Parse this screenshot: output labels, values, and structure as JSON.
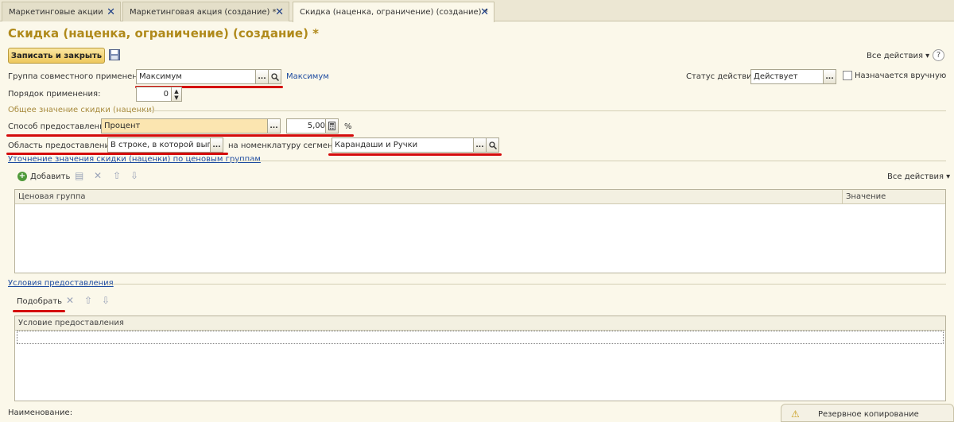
{
  "tabs": [
    {
      "label": "Маркетинговые акции"
    },
    {
      "label": "Маркетинговая акция (создание) *"
    },
    {
      "label": "Скидка (наценка, ограничение) (создание) *"
    }
  ],
  "page_title": "Скидка (наценка, ограничение) (создание) *",
  "toolbar": {
    "save_close": "Записать и закрыть",
    "all_actions": "Все действия"
  },
  "group": {
    "label": "Группа совместного применения:",
    "value": "Максимум",
    "link": "Максимум"
  },
  "status": {
    "label": "Статус действия:",
    "value": "Действует",
    "checkbox_label": "Назначается вручную"
  },
  "order": {
    "label": "Порядок применения:",
    "value": "0"
  },
  "section_general": "Общее значение скидки (наценки)",
  "method": {
    "label": "Способ предоставления:",
    "value": "Процент",
    "amount": "5,00",
    "unit": "%"
  },
  "scope": {
    "label": "Область предоставления:",
    "value": "В строке, в которой выполн",
    "segment_label": "на номенклатуру сегмента:",
    "segment_value": "Карандаши и Ручки"
  },
  "refine_link": "Уточнение значения скидки (наценки) по ценовым группам",
  "price_table": {
    "add": "Добавить",
    "all_actions": "Все действия",
    "col_group": "Ценовая группа",
    "col_value": "Значение"
  },
  "conditions": {
    "link": "Условия предоставления",
    "pick": "Подобрать",
    "col": "Условие предоставления"
  },
  "name_label": "Наименование:",
  "notification": "Резервное копирование"
}
